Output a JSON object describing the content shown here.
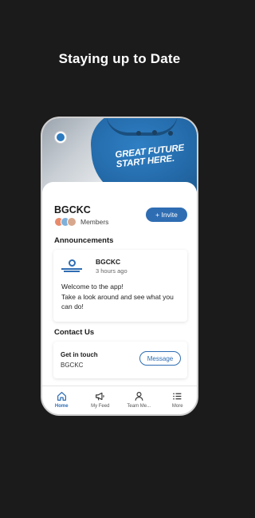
{
  "headline": "Staying up to Date",
  "hero": {
    "slogan_line1": "GREAT FUTURE",
    "slogan_line2": "START HERE."
  },
  "org": {
    "name": "BGCKC",
    "members_label": "Members",
    "invite_label": "+ Invite"
  },
  "announcements": {
    "title": "Announcements",
    "post": {
      "author": "BGCKC",
      "time": "3 hours ago",
      "body": "Welcome to the app!\nTake a look around and see what you can do!"
    }
  },
  "contact": {
    "title": "Contact Us",
    "card_title": "Get in touch",
    "card_sub": "BGCKC",
    "button_label": "Message"
  },
  "tabs": [
    {
      "label": "Home",
      "icon": "home-icon",
      "active": true
    },
    {
      "label": "My Feed",
      "icon": "megaphone-icon",
      "active": false
    },
    {
      "label": "Team Me...",
      "icon": "person-icon",
      "active": false
    },
    {
      "label": "More",
      "icon": "list-icon",
      "active": false
    }
  ],
  "colors": {
    "accent": "#2f6db3",
    "background": "#1b1b1b"
  }
}
